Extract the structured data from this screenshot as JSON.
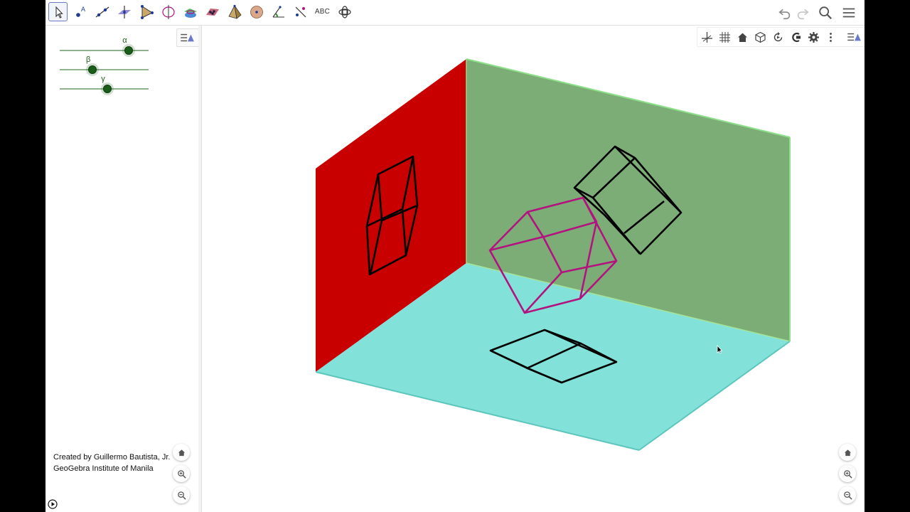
{
  "toolbar": {
    "tools": [
      {
        "icon": "move-tool-icon",
        "selected": true
      },
      {
        "icon": "point-tool-icon"
      },
      {
        "icon": "line-tool-icon"
      },
      {
        "icon": "perpendicular-line-tool-icon"
      },
      {
        "icon": "polygon-tool-icon"
      },
      {
        "icon": "circle-around-line-tool-icon"
      },
      {
        "icon": "intersect-surfaces-tool-icon"
      },
      {
        "icon": "plane-tool-icon"
      },
      {
        "icon": "pyramid-tool-icon"
      },
      {
        "icon": "sphere-tool-icon"
      },
      {
        "icon": "angle-tool-icon"
      },
      {
        "icon": "reflect-tool-icon"
      },
      {
        "icon": "text-tool-icon",
        "label": "ABC"
      },
      {
        "icon": "rotate-view-tool-icon"
      }
    ],
    "right_icons": [
      "undo-icon",
      "redo-icon",
      "search-icon",
      "menu-icon"
    ]
  },
  "algebra": {
    "sliders": [
      {
        "label": "α",
        "value": 0.77
      },
      {
        "label": "β",
        "value": 0.36
      },
      {
        "label": "γ",
        "value": 0.53
      }
    ]
  },
  "credits": {
    "line1": "Created by Guillermo Bautista, Jr.",
    "line2": "GeoGebra Institute of Manila"
  },
  "graphics_toolbar": [
    "axes-icon",
    "grid-icon",
    "home-view-icon",
    "cube-view-icon",
    "rotate-view-icon",
    "clipping-icon",
    "settings-icon",
    "more-options-icon",
    "style-bar-toggle-icon"
  ],
  "colors": {
    "left_wall": "#c80000",
    "back_wall": "#7cad77",
    "floor": "#82e2d9",
    "projection_edges": "#000000",
    "cube_edges": "#b3137f",
    "slider_knob": "#1a5c1a"
  }
}
